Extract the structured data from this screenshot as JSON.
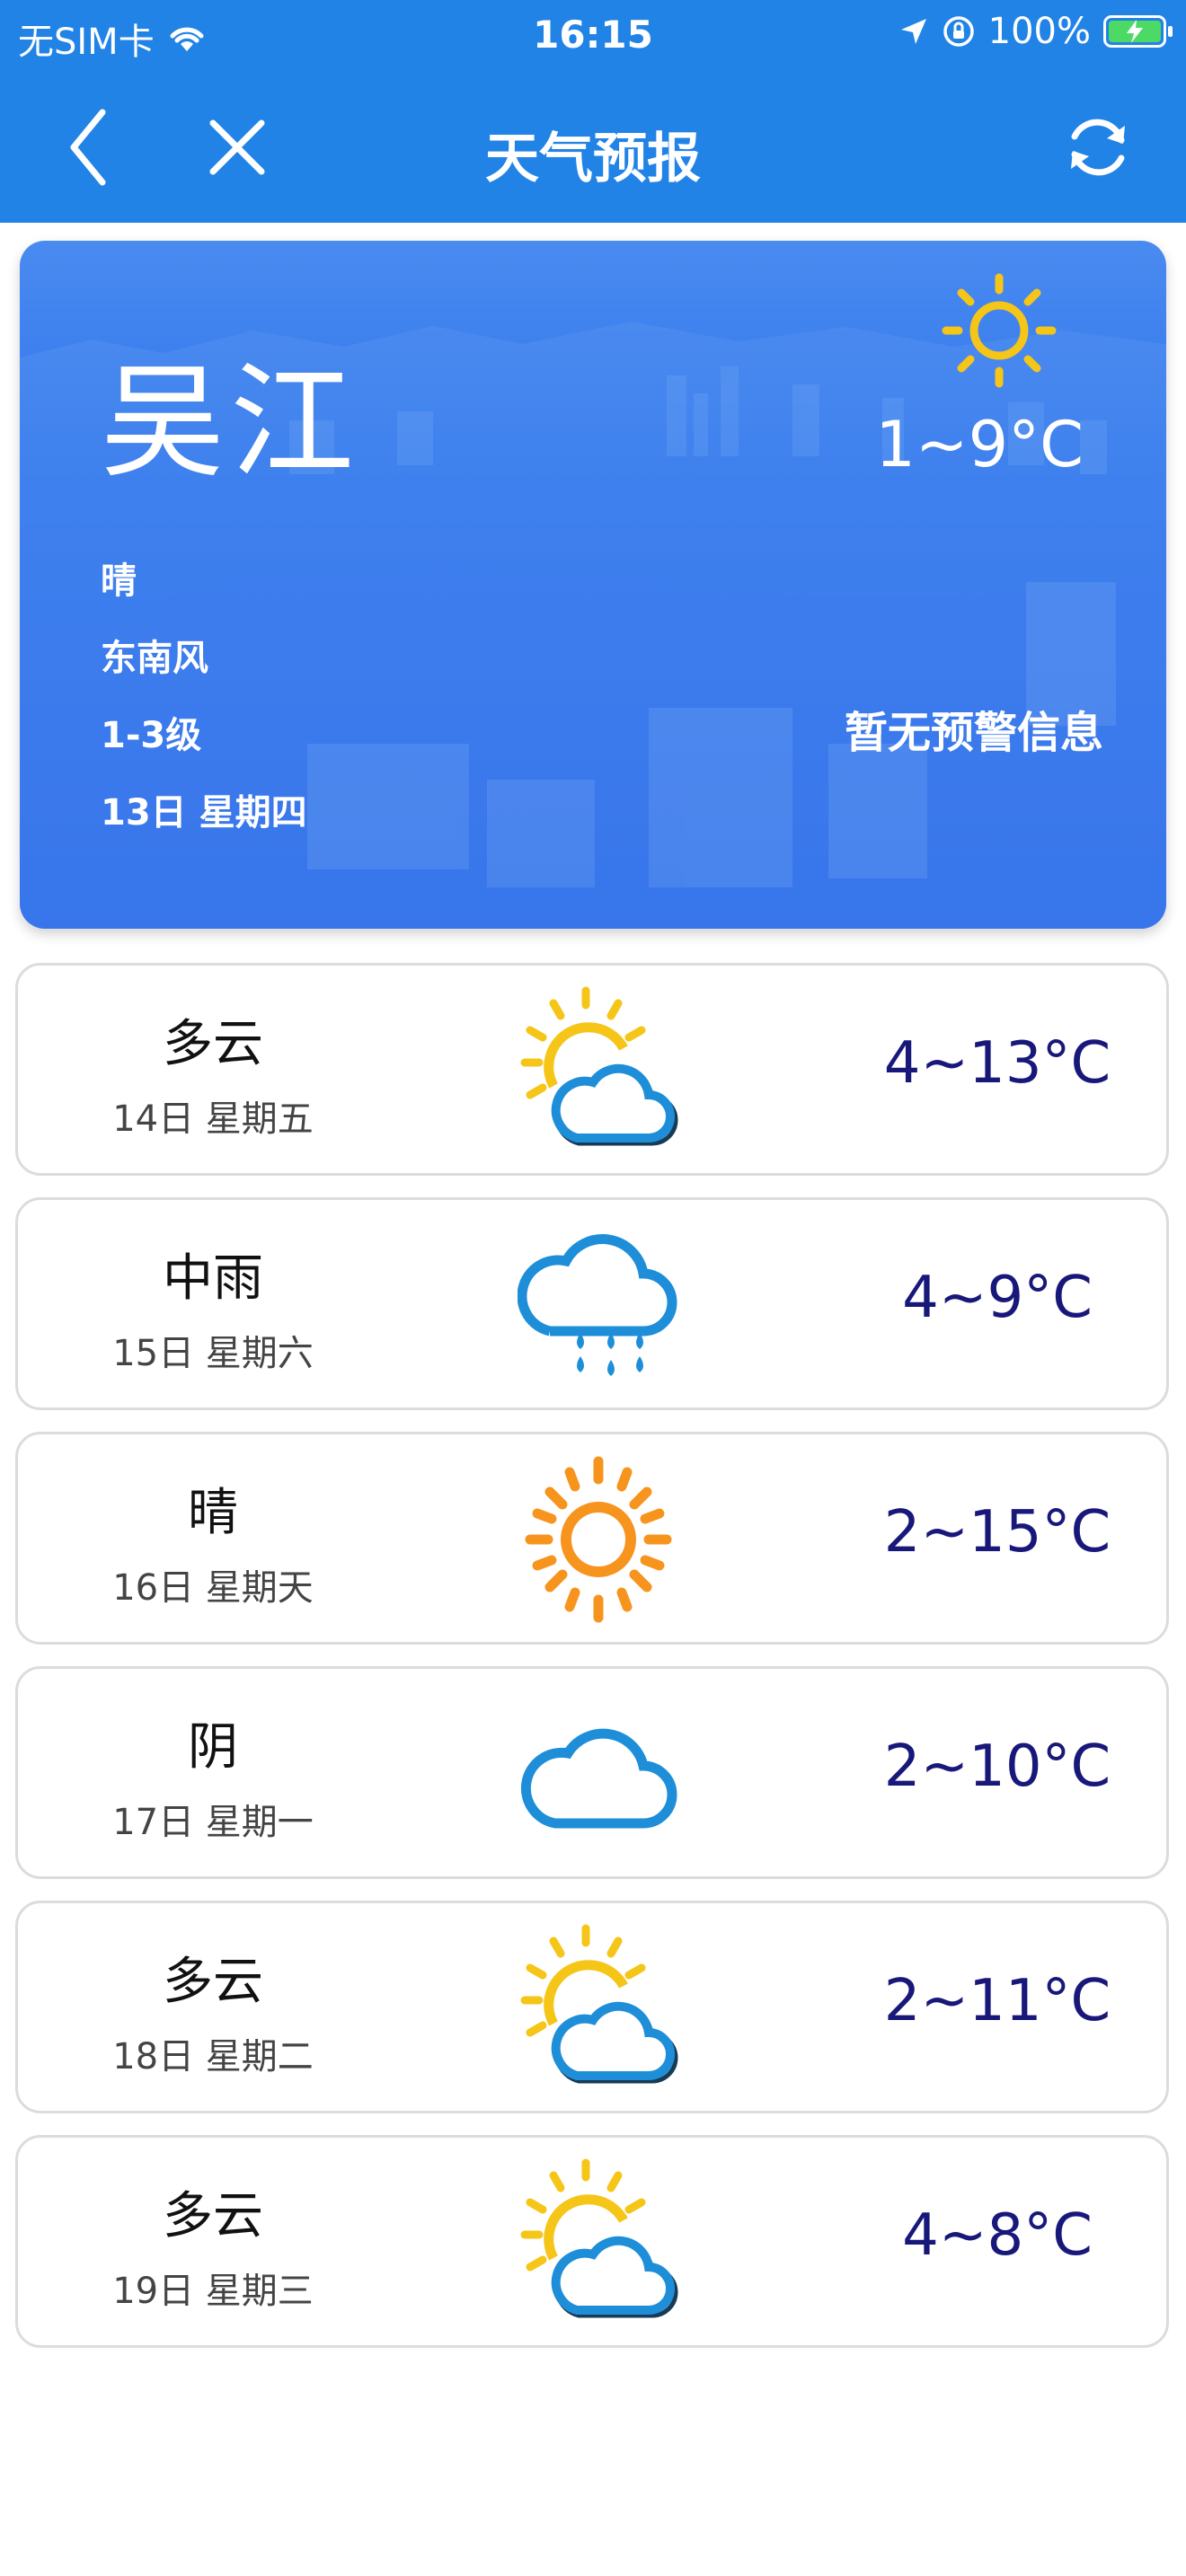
{
  "status_bar": {
    "carrier": "无SIM卡",
    "time": "16:15",
    "battery_percent": "100%",
    "battery_level": 1.0,
    "icons": [
      "wifi-icon",
      "location-arrow-icon",
      "orientation-lock-icon",
      "battery-charging-icon"
    ]
  },
  "nav": {
    "title": "天气预报",
    "back_icon": "chevron-left-icon",
    "close_icon": "close-icon",
    "refresh_icon": "refresh-icon"
  },
  "today": {
    "city": "吴江",
    "condition": "晴",
    "wind_direction": "东南风",
    "wind_level": "1-3级",
    "date": "13日 星期四",
    "temp_range": "1~9°C",
    "alert": "暂无预警信息",
    "icon": "sunny-icon"
  },
  "forecast": [
    {
      "condition": "多云",
      "date": "14日 星期五",
      "temp_range": "4~13°C",
      "icon": "partly-cloudy-icon"
    },
    {
      "condition": "中雨",
      "date": "15日 星期六",
      "temp_range": "4~9°C",
      "icon": "rain-icon"
    },
    {
      "condition": "晴",
      "date": "16日 星期天",
      "temp_range": "2~15°C",
      "icon": "sunny-icon"
    },
    {
      "condition": "阴",
      "date": "17日 星期一",
      "temp_range": "2~10°C",
      "icon": "cloudy-icon"
    },
    {
      "condition": "多云",
      "date": "18日 星期二",
      "temp_range": "2~11°C",
      "icon": "partly-cloudy-icon"
    },
    {
      "condition": "多云",
      "date": "19日 星期三",
      "temp_range": "4~8°C",
      "icon": "partly-cloudy-icon"
    }
  ],
  "colors": {
    "header_blue": "#2183e6",
    "card_blue": "#2f74ec",
    "sun_yellow": "#f5c518",
    "sun_orange": "#f7941d",
    "cloud_blue": "#1e8ed8",
    "temp_text": "#18187a",
    "battery_green": "#4cd964"
  }
}
